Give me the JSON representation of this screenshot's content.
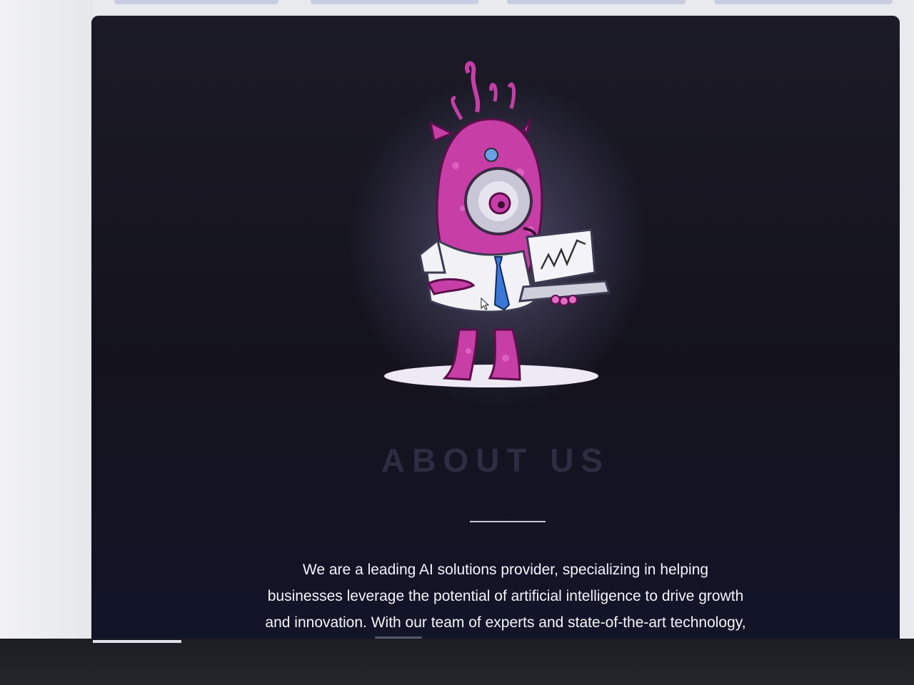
{
  "about": {
    "title": "ABOUT US",
    "paragraph_lines": [
      "We are a leading AI solutions provider, specializing in helping",
      "businesses leverage the potential of artificial intelligence to drive growth",
      "and innovation. With our team of experts and state-of-the-art technology,"
    ]
  },
  "hero": {
    "icon": "monster-with-laptop-illustration"
  },
  "colors": {
    "background": "#14131d",
    "monster": "#c63ea6",
    "text": "#f3f4f8",
    "title": "#2b2d40"
  }
}
